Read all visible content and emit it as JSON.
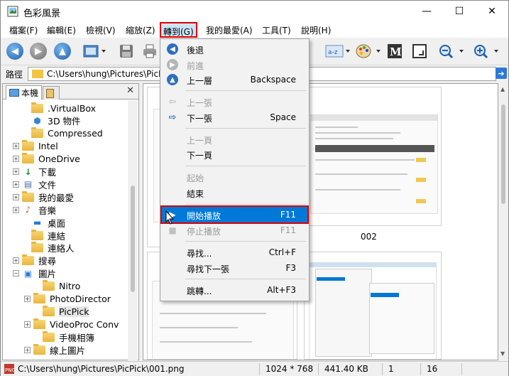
{
  "window": {
    "title": "色彩風景",
    "minimize": "—",
    "maximize": "☐",
    "close": "✕"
  },
  "menubar": [
    {
      "label": "檔案(F)"
    },
    {
      "label": "編輯(E)"
    },
    {
      "label": "檢視(V)"
    },
    {
      "label": "縮放(Z)"
    },
    {
      "label": "轉到(G)"
    },
    {
      "label": "我的最愛(A)"
    },
    {
      "label": "工具(T)"
    },
    {
      "label": "說明(H)"
    }
  ],
  "address": {
    "label": "路徑",
    "path": "C:\\Users\\hung\\Pictures\\PicPick\\"
  },
  "tabs": [
    {
      "label": "本機"
    },
    {
      "label": ""
    }
  ],
  "tree": [
    {
      "label": ".VirtualBox"
    },
    {
      "label": "3D 物件"
    },
    {
      "label": "Compressed"
    },
    {
      "label": "Intel"
    },
    {
      "label": "OneDrive"
    },
    {
      "label": "下載"
    },
    {
      "label": "文件"
    },
    {
      "label": "我的最愛"
    },
    {
      "label": "音樂"
    },
    {
      "label": "桌面"
    },
    {
      "label": "連結"
    },
    {
      "label": "連絡人"
    },
    {
      "label": "搜尋"
    },
    {
      "label": "圖片"
    },
    {
      "label": "Nitro"
    },
    {
      "label": "PhotoDirector"
    },
    {
      "label": "PicPick"
    },
    {
      "label": "VideoProc Conv"
    },
    {
      "label": "手機相簿"
    },
    {
      "label": "線上圖片"
    }
  ],
  "thumbnails": [
    {
      "label": "002"
    }
  ],
  "goto_menu": [
    {
      "label": "後退",
      "shortcut": "",
      "disabled": false
    },
    {
      "label": "前進",
      "shortcut": "",
      "disabled": true
    },
    {
      "label": "上一層",
      "shortcut": "Backspace",
      "disabled": false
    },
    {
      "label": "上一張",
      "shortcut": "",
      "disabled": true
    },
    {
      "label": "下一張",
      "shortcut": "Space",
      "disabled": false
    },
    {
      "label": "上一頁",
      "shortcut": "",
      "disabled": true
    },
    {
      "label": "下一頁",
      "shortcut": "",
      "disabled": false
    },
    {
      "label": "起始",
      "shortcut": "",
      "disabled": true
    },
    {
      "label": "結束",
      "shortcut": "",
      "disabled": false
    },
    {
      "label": "開始播放",
      "shortcut": "F11",
      "disabled": false
    },
    {
      "label": "停止播放",
      "shortcut": "F11",
      "disabled": true
    },
    {
      "label": "尋找...",
      "shortcut": "Ctrl+F",
      "disabled": false
    },
    {
      "label": "尋找下一張",
      "shortcut": "F3",
      "disabled": false
    },
    {
      "label": "跳轉...",
      "shortcut": "Alt+F3",
      "disabled": false
    }
  ],
  "status": {
    "path": "C:\\Users\\hung\\Pictures\\PicPick\\001.png",
    "dimensions": "1024 * 768",
    "size": "441.40 KB",
    "index": "1",
    "count": "16"
  },
  "colors": {
    "accent": "#0078d7",
    "highlight_border": "#e00000",
    "menu_active": "#cce4f7"
  }
}
